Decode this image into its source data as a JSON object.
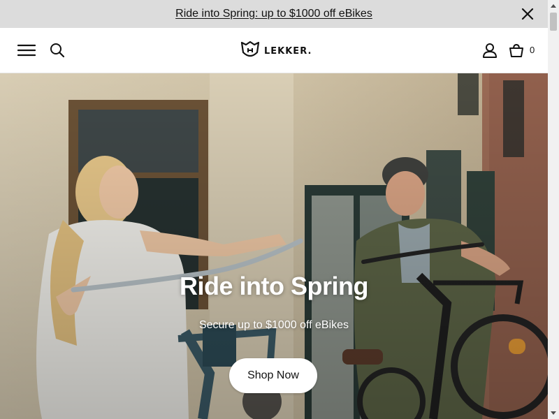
{
  "announcement": {
    "text": "Ride into Spring: up to $1000 off eBikes",
    "close_icon": "close-icon"
  },
  "header": {
    "menu_icon": "hamburger-menu-icon",
    "search_icon": "search-icon",
    "logo_text": "LEKKER.",
    "account_icon": "user-icon",
    "cart_icon": "shopping-basket-icon",
    "cart_count": "0"
  },
  "hero": {
    "title": "Ride into Spring",
    "subtitle": "Secure up to $1000 off eBikes",
    "cta_label": "Shop Now"
  },
  "colors": {
    "announcement_bg": "#dcdcdc",
    "header_bg": "#ffffff",
    "cta_bg": "#ffffff",
    "text": "#111111"
  }
}
